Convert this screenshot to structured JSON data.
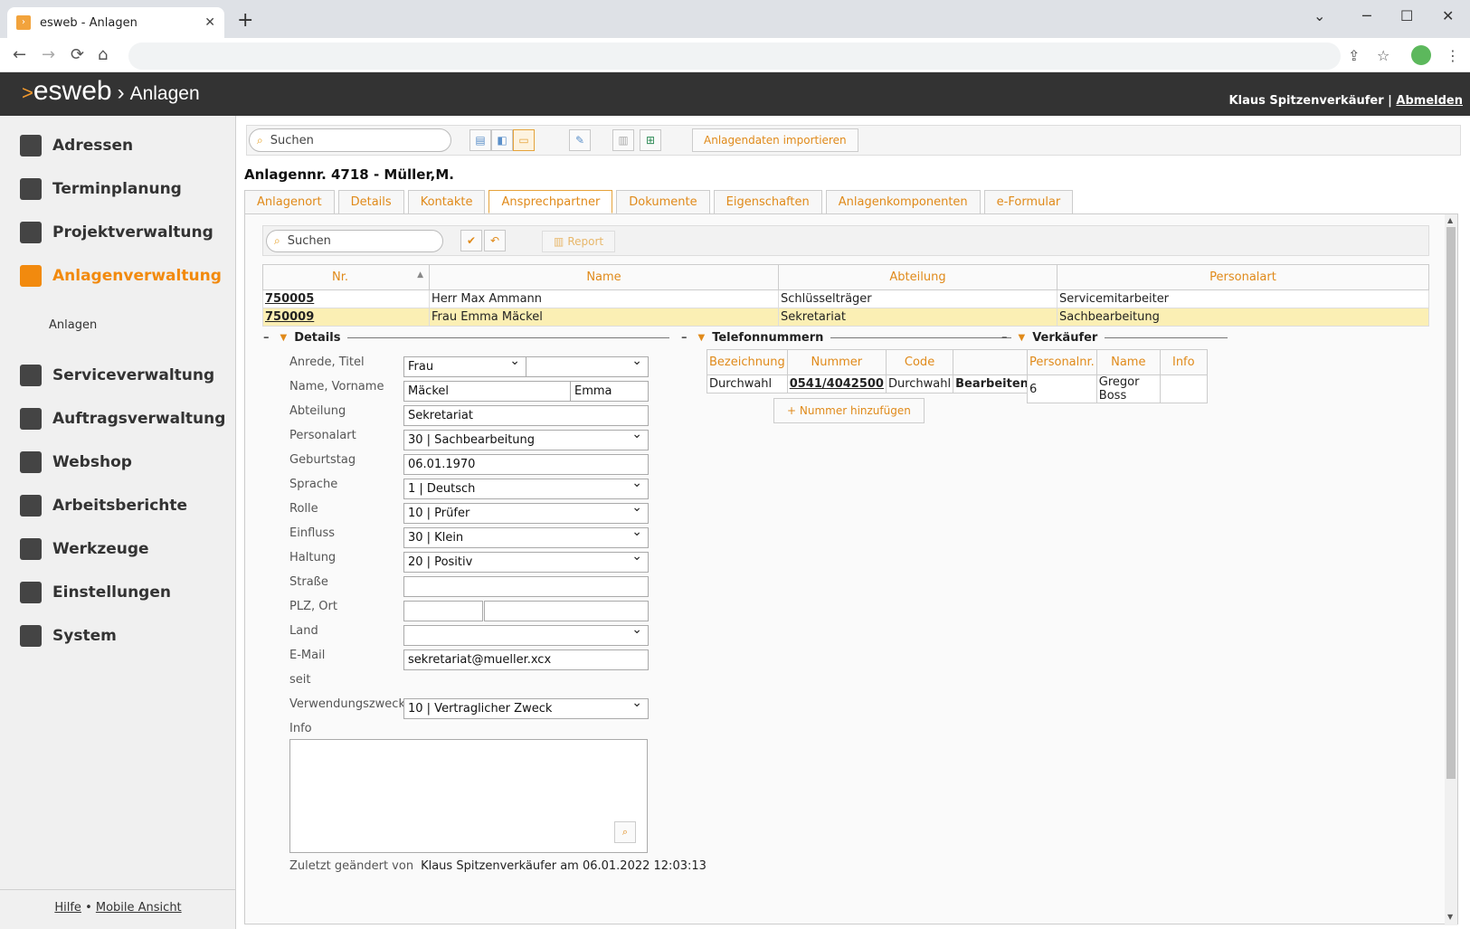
{
  "browser": {
    "tab_title": "esweb - Anlagen",
    "new_tab": "+",
    "win_min": "⌄",
    "win_min2": "─",
    "win_max": "☐",
    "win_close": "✕",
    "back": "←",
    "forward": "→",
    "reload": "⟳",
    "home": "⌂",
    "share": "⇪",
    "star": "☆",
    "menu": "⋮"
  },
  "header": {
    "logo_mark": ">",
    "logo": "esweb",
    "logo_sep": "›",
    "module": "Anlagen",
    "user": "Klaus Spitzenverkäufer",
    "divider": "|",
    "logout": "Abmelden"
  },
  "sidebar": {
    "items": [
      {
        "label": "Adressen",
        "icon": "address-book-icon"
      },
      {
        "label": "Terminplanung",
        "icon": "calendar-icon"
      },
      {
        "label": "Projektverwaltung",
        "icon": "project-icon"
      },
      {
        "label": "Anlagenverwaltung",
        "icon": "factory-icon",
        "active": true
      },
      {
        "label": "Serviceverwaltung",
        "icon": "headset-icon"
      },
      {
        "label": "Auftragsverwaltung",
        "icon": "list-icon"
      },
      {
        "label": "Webshop",
        "icon": "cart-icon"
      },
      {
        "label": "Arbeitsberichte",
        "icon": "clipboard-icon"
      },
      {
        "label": "Werkzeuge",
        "icon": "tools-icon"
      },
      {
        "label": "Einstellungen",
        "icon": "gears-icon"
      },
      {
        "label": "System",
        "icon": "database-icon"
      }
    ],
    "sub_item": "Anlagen",
    "footer_help": "Hilfe",
    "footer_dot": "•",
    "footer_mobile": "Mobile Ansicht"
  },
  "toolbar": {
    "search_placeholder": "Suchen",
    "import_label": "Anlagendaten importieren"
  },
  "page_title": "Anlagennr. 4718 - Müller,M.",
  "tabs": [
    "Anlagenort",
    "Details",
    "Kontakte",
    "Ansprechpartner",
    "Dokumente",
    "Eigenschaften",
    "Anlagenkomponenten",
    "e-Formular"
  ],
  "active_tab": "Ansprechpartner",
  "contacts": {
    "search_placeholder": "Suchen",
    "report_label": "Report",
    "columns": [
      "Nr.",
      "Name",
      "Abteilung",
      "Personalart"
    ],
    "rows": [
      {
        "nr": "750005",
        "name": "Herr Max Ammann",
        "abteilung": "Schlüsselträger",
        "personalart": "Servicemitarbeiter"
      },
      {
        "nr": "750009",
        "name": "Frau Emma Mäckel",
        "abteilung": "Sekretariat",
        "personalart": "Sachbearbeitung"
      }
    ]
  },
  "details": {
    "title": "Details",
    "labels": {
      "anrede": "Anrede, Titel",
      "name": "Name, Vorname",
      "abteilung": "Abteilung",
      "personalart": "Personalart",
      "geburtstag": "Geburtstag",
      "sprache": "Sprache",
      "rolle": "Rolle",
      "einfluss": "Einfluss",
      "haltung": "Haltung",
      "strasse": "Straße",
      "plz": "PLZ, Ort",
      "land": "Land",
      "email": "E-Mail",
      "seit": "seit",
      "zweck": "Verwendungszweck",
      "info": "Info"
    },
    "values": {
      "anrede": "Frau",
      "titel": "",
      "name": "Mäckel",
      "vorname": "Emma",
      "abteilung": "Sekretariat",
      "personalart": "30 | Sachbearbeitung",
      "geburtstag": "06.01.1970",
      "sprache": "1 | Deutsch",
      "rolle": "10 | Prüfer",
      "einfluss": "30 | Klein",
      "haltung": "20 | Positiv",
      "strasse": "",
      "plz": "",
      "ort": "",
      "land": "",
      "email": "sekretariat@mueller.xcx",
      "zweck": "10 | Vertraglicher Zweck"
    },
    "changed_label": "Zuletzt geändert von",
    "changed_value": "Klaus Spitzenverkäufer am 06.01.2022 12:03:13"
  },
  "phones": {
    "title": "Telefonnummern",
    "columns": [
      "Bezeichnung",
      "Nummer",
      "Code",
      ""
    ],
    "rows": [
      {
        "bezeichnung": "Durchwahl",
        "nummer": "0541/4042500",
        "code": "Durchwahl",
        "action": "Bearbeiten"
      }
    ],
    "add_label": "+  Nummer hinzufügen"
  },
  "seller": {
    "title": "Verkäufer",
    "columns": [
      "Personalnr.",
      "Name",
      "Info"
    ],
    "rows": [
      {
        "personalnr": "6",
        "name": "Gregor Boss",
        "info": ""
      }
    ]
  }
}
